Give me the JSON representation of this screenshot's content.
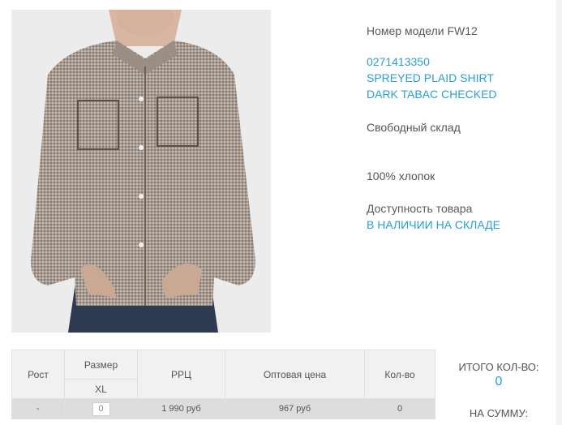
{
  "product": {
    "image_alt": "Product photo: plaid shirt",
    "model_label": "Номер модели FW12",
    "code": "0271413350",
    "name": "SPREYED PLAID SHIRT",
    "color": "DARK TABAC CHECKED",
    "stock_type": "Свободный склад",
    "material": "100% хлопок",
    "availability_label": "Доступность товара",
    "availability_value": "В НАЛИЧИИ НА СКЛАДЕ"
  },
  "order_table": {
    "headers": {
      "height": "Рост",
      "size": "Размер",
      "size_value": "XL",
      "rrp": "РРЦ",
      "wholesale": "Оптовая цена",
      "qty": "Кол-во"
    },
    "row": {
      "height": "-",
      "size_input": "0",
      "rrp": "1 990 руб",
      "wholesale": "967 руб",
      "qty": "0"
    }
  },
  "totals": {
    "qty_label": "ИТОГО КОЛ-ВО:",
    "qty_value": "0",
    "sum_label": "НА СУММУ:"
  },
  "colors": {
    "accent": "#2a9fd6",
    "text": "#555555",
    "header_bg": "#f1f1f1",
    "row_bg": "#dddddd"
  }
}
